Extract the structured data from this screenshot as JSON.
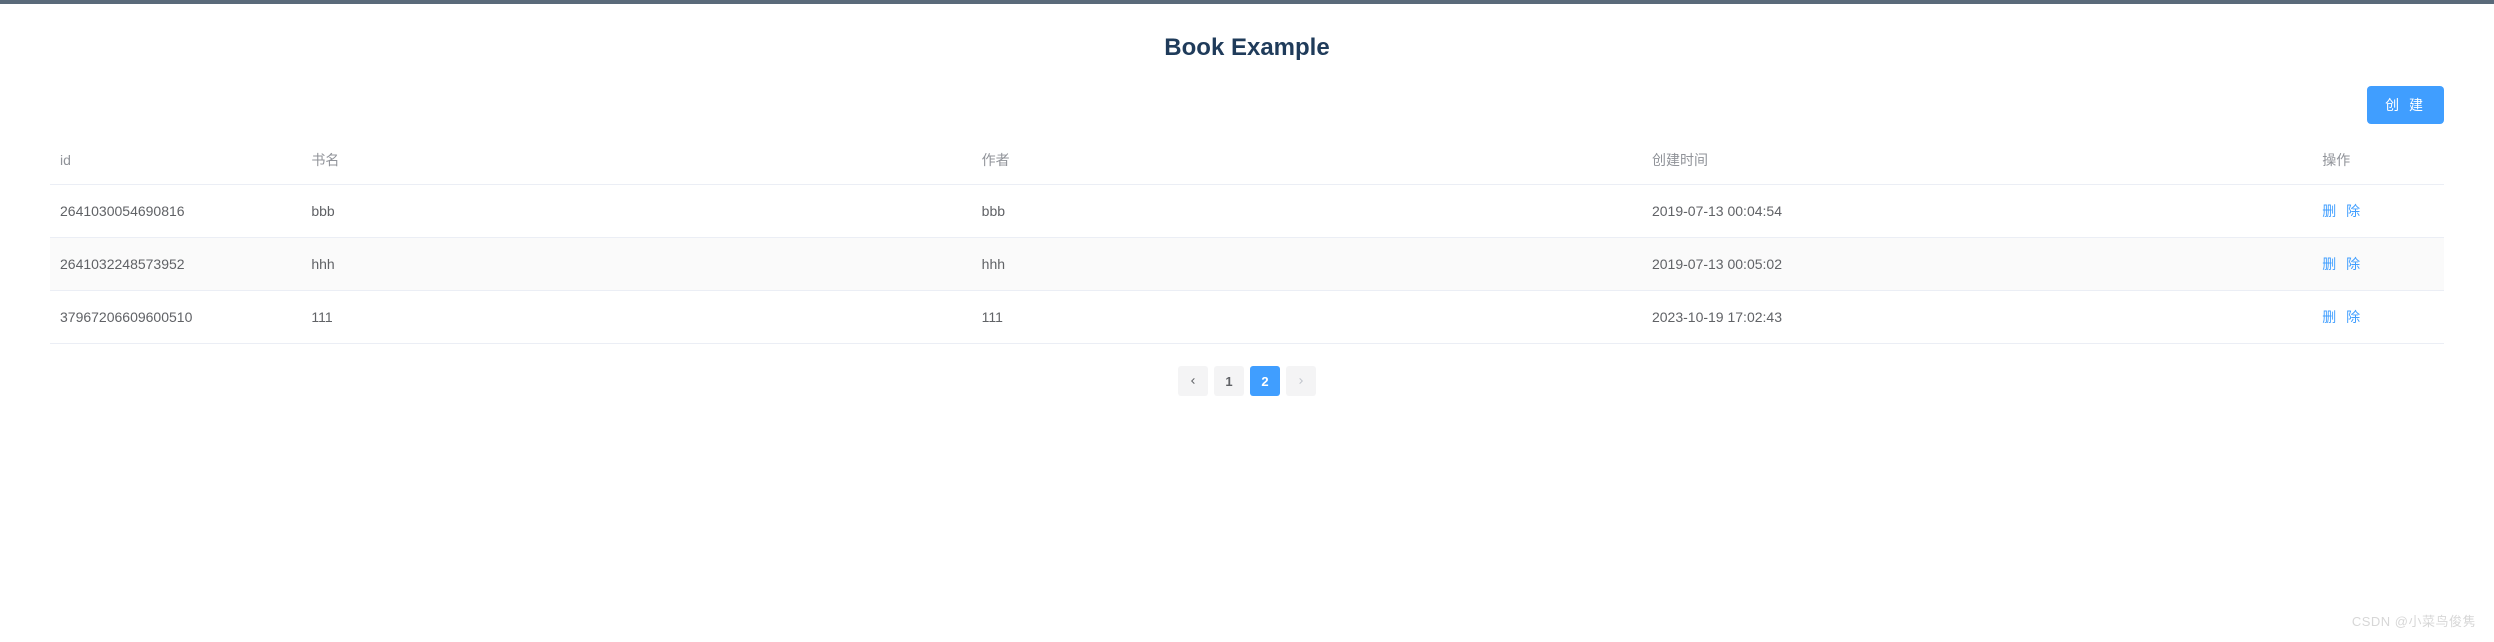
{
  "page": {
    "title": "Book Example"
  },
  "toolbar": {
    "create_label": "创 建"
  },
  "table": {
    "headers": {
      "id": "id",
      "name": "书名",
      "author": "作者",
      "created_at": "创建时间",
      "ops": "操作"
    },
    "rows": [
      {
        "id": "2641030054690816",
        "name": "bbb",
        "author": "bbb",
        "created_at": "2019-07-13 00:04:54"
      },
      {
        "id": "2641032248573952",
        "name": "hhh",
        "author": "hhh",
        "created_at": "2019-07-13 00:05:02"
      },
      {
        "id": "37967206609600510",
        "name": "111",
        "author": "111",
        "created_at": "2023-10-19 17:02:43"
      }
    ],
    "delete_label": "删 除"
  },
  "pagination": {
    "pages": [
      "1",
      "2"
    ],
    "active": "2"
  },
  "watermark": "CSDN @小菜鸟俊隽"
}
